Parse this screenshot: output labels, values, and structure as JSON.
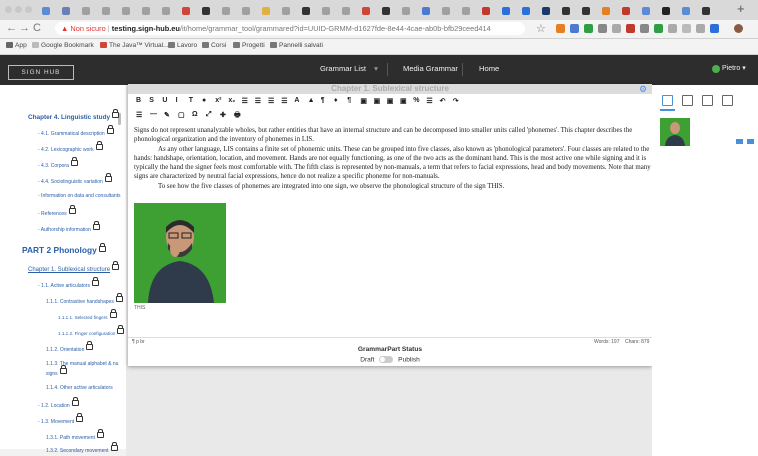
{
  "browser": {
    "new_tab_symbol": "+",
    "not_secure_label": "Non sicuro",
    "url_host": "testing.sign-hub.eu",
    "url_path": "/it/home/grammar_tool/grammared?id=UUID-GRMM-d1627fde-8e44-4cae-ab0b-bfb29ceed414",
    "tabs": [
      {
        "name": "tab-1",
        "color": "#5b8bd6"
      },
      {
        "name": "tab-2",
        "color": "#6a7fb5"
      },
      {
        "name": "tab-3",
        "color": "#a0a0a0"
      },
      {
        "name": "tab-4",
        "color": "#a0a0a0"
      },
      {
        "name": "tab-5",
        "color": "#a0a0a0"
      },
      {
        "name": "tab-6",
        "color": "#a0a0a0"
      },
      {
        "name": "tab-7",
        "color": "#a0a0a0"
      },
      {
        "name": "tab-8",
        "color": "#d0453a"
      },
      {
        "name": "tab-9",
        "color": "#333333"
      },
      {
        "name": "tab-10",
        "color": "#a0a0a0"
      },
      {
        "name": "tab-11",
        "color": "#a0a0a0"
      },
      {
        "name": "tab-12",
        "color": "#e0b040"
      },
      {
        "name": "tab-13",
        "color": "#a0a0a0"
      },
      {
        "name": "tab-14",
        "color": "#333333"
      },
      {
        "name": "tab-15",
        "color": "#a0a0a0"
      },
      {
        "name": "tab-16",
        "color": "#a0a0a0"
      },
      {
        "name": "tab-17",
        "color": "#d0453a"
      },
      {
        "name": "tab-18",
        "color": "#333333"
      },
      {
        "name": "tab-19",
        "color": "#a0a0a0"
      },
      {
        "name": "tab-20",
        "color": "#4a7bd0"
      },
      {
        "name": "tab-21",
        "color": "#a0a0a0"
      },
      {
        "name": "tab-22",
        "color": "#a0a0a0"
      },
      {
        "name": "tab-23",
        "color": "#c0392b"
      },
      {
        "name": "tab-24",
        "color": "#2a6fdb"
      },
      {
        "name": "tab-25",
        "color": "#2a6fdb"
      },
      {
        "name": "tab-26",
        "color": "#1a3a6a"
      },
      {
        "name": "tab-27",
        "color": "#333333"
      },
      {
        "name": "tab-28",
        "color": "#333333"
      },
      {
        "name": "tab-29",
        "color": "#e67e22"
      },
      {
        "name": "tab-30",
        "color": "#c0392b"
      },
      {
        "name": "tab-31",
        "color": "#5b8bd6"
      },
      {
        "name": "tab-32",
        "color": "#222222"
      },
      {
        "name": "tab-33",
        "color": "#5b8bd6"
      },
      {
        "name": "tab-34",
        "color": "#333333"
      }
    ],
    "bookmarks": [
      "App",
      "Google Bookmark",
      "The Java™ Virtual...",
      "Lavoro",
      "Corsi",
      "Progetti",
      "Pannelli salvati"
    ]
  },
  "app": {
    "logo_text": "SIGN HUB",
    "nav": [
      "Grammar List",
      "Media Grammar",
      "Home"
    ],
    "nav_caret": "▾",
    "user_name": "Pietro",
    "user_caret": "▾"
  },
  "sidebar": {
    "items": [
      {
        "text": "Chapter 4. Linguistic study",
        "lock": true
      },
      {
        "text": "- 4.1. Grammatical description",
        "lock": true
      },
      {
        "text": "- 4.2. Lexicographic work",
        "lock": true
      },
      {
        "text": "- 4.3. Corpora",
        "lock": true
      },
      {
        "text": "- 4.4. Sociolinguistic variation",
        "lock": true
      },
      {
        "text": "- Information on data and consultants",
        "lock": false
      },
      {
        "text": "- References",
        "lock": true
      },
      {
        "text": "- Authorship information",
        "lock": true
      },
      {
        "text": "PART 2 Phonology",
        "lock": true
      },
      {
        "text": "Chapter 1. Sublexical structure",
        "lock": true
      },
      {
        "text": "- 1.1. Active articulators",
        "lock": true
      },
      {
        "text": "1.1.1. Contrastive handshapes",
        "lock": true
      },
      {
        "text": "1.1.1.1. Selected fingers",
        "lock": true
      },
      {
        "text": "1.1.1.2. Finger configuration",
        "lock": true
      },
      {
        "text": "1.1.2. Orientation",
        "lock": true
      },
      {
        "text": "1.1.3. The manual alphabet & nu",
        "lock": false
      },
      {
        "text": "signs",
        "lock": true
      },
      {
        "text": "1.1.4. Other active articulators",
        "lock": false
      },
      {
        "text": "- 1.2. Location",
        "lock": true
      },
      {
        "text": "- 1.3. Movement",
        "lock": true
      },
      {
        "text": "1.3.1. Path movement",
        "lock": true
      },
      {
        "text": "1.3.2. Secondary movement",
        "lock": true
      }
    ]
  },
  "editor": {
    "title": "Chapter 1. Sublexical structure",
    "toolbar1": [
      "B",
      "S",
      "U",
      "I",
      "T",
      "●",
      "x²",
      "x₂",
      "☰",
      "☰",
      "☰",
      "☰",
      "A",
      "▲",
      "¶",
      "♦",
      "¶",
      "▣",
      "▣",
      "▣",
      "▣",
      "%",
      "☰",
      "↶",
      "↷"
    ],
    "toolbar2": [
      "☰",
      "—",
      "✎",
      "▢",
      "Ω",
      "⤢",
      "✚",
      "🖶"
    ],
    "paragraphs": [
      "Signs do not represent unanalyzable wholes, but rather entities that have an internal structure and can be decomposed into smaller units called 'phonemes'. This chapter describes the phonological organization and the inventory of phonemes in LIS.",
      "As any other language, LIS contains a finite set of phonemic units. These can be grouped into five classes, also known as 'phonological parameters'. Four classes are related to the hands: handshape, orientation, location, and movement. Hands are not equally functioning, as one of the two acts as the dominant hand. This is the most active one while signing and it is typically the hand the signer feels most comfortable with. The fifth class is represented by non-manuals, a term that refers to facial expressions, head and body movements. Note that many signs are characterized by neutral facial expressions, hence do not realize a specific phoneme for non-manuals.",
      "To see how the five classes of phonemes are integrated into one sign, we observe the phonological structure of the sign THIS."
    ],
    "caption": "THIS",
    "status_left": "¶  p  br",
    "words": "Words: 197",
    "chars": "Chars: 879",
    "status_title": "GrammarPart Status",
    "draft_label": "Draft",
    "publish_label": "Publish"
  },
  "icons": {
    "gear": "⚙",
    "back": "←",
    "forward": "→",
    "reload": "C",
    "warning": "▲",
    "star": "☆"
  },
  "colors": {
    "accent_blue": "#2a5ea8",
    "navbar": "#2d2d2d",
    "green_screen": "#3ea033"
  }
}
